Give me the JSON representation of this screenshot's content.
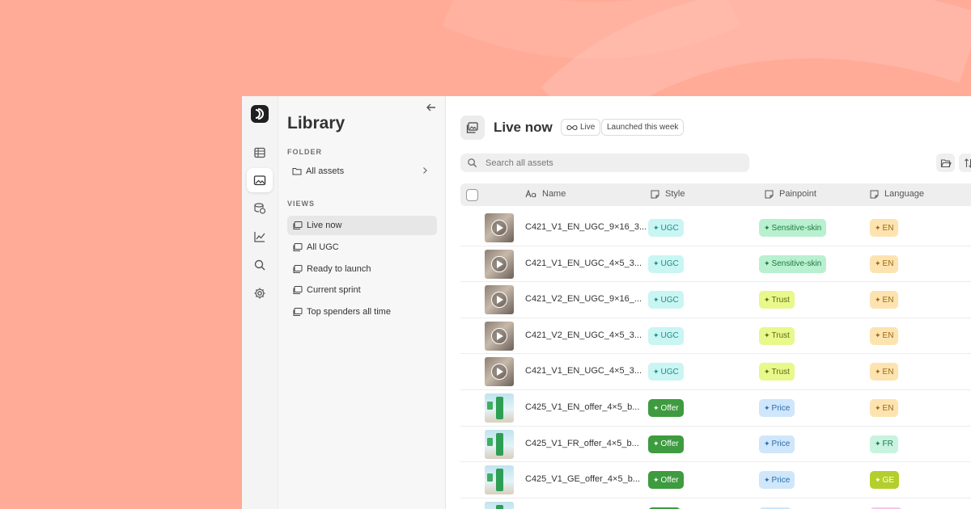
{
  "colors": {
    "background": "#ffab98",
    "tag_ugc_bg": "#c9f5f3",
    "tag_ugc_fg": "#1b8f8a",
    "tag_offer_bg": "#3e9b3f",
    "tag_offer_fg": "#ffffff",
    "tag_sensitive_bg": "#b9f0cf",
    "tag_sensitive_fg": "#1f7a44",
    "tag_trust_bg": "#e8f88b",
    "tag_trust_fg": "#5d6b12",
    "tag_price_bg": "#cfe6fb",
    "tag_price_fg": "#2d6ea8",
    "tag_en_bg": "#fde3b0",
    "tag_en_fg": "#9a6a14",
    "tag_fr_bg": "#c7f3df",
    "tag_fr_fg": "#1f7a55",
    "tag_ge_bg": "#b4cf2c",
    "tag_ge_fg": "#ffffff"
  },
  "rail": {
    "items": [
      {
        "name": "table-icon",
        "active": false
      },
      {
        "name": "image-folder-icon",
        "active": true
      },
      {
        "name": "coins-icon",
        "active": false
      },
      {
        "name": "trend-chart-icon",
        "active": false
      },
      {
        "name": "search-icon",
        "active": false
      },
      {
        "name": "gear-icon",
        "active": false
      }
    ]
  },
  "library": {
    "title": "Library",
    "folder_label": "FOLDER",
    "folder_item": "All assets",
    "views_label": "VIEWS",
    "views": [
      "Live now",
      "All UGC",
      "Ready to launch",
      "Current sprint",
      "Top spenders all time"
    ]
  },
  "main": {
    "title": "Live now",
    "chips": [
      "Live",
      "Launched this week"
    ],
    "search_placeholder": "Search all assets",
    "columns": [
      "Name",
      "Style",
      "Painpoint",
      "Language"
    ],
    "rows": [
      {
        "thumb": "ugc",
        "name": "C421_V1_EN_UGC_9×16_3...",
        "style": "UGC",
        "painpoint": "Sensitive-skin",
        "language": "EN"
      },
      {
        "thumb": "ugc",
        "name": "C421_V1_EN_UGC_4×5_3...",
        "style": "UGC",
        "painpoint": "Sensitive-skin",
        "language": "EN"
      },
      {
        "thumb": "ugc",
        "name": "C421_V2_EN_UGC_9×16_...",
        "style": "UGC",
        "painpoint": "Trust",
        "language": "EN"
      },
      {
        "thumb": "ugc",
        "name": "C421_V2_EN_UGC_4×5_3...",
        "style": "UGC",
        "painpoint": "Trust",
        "language": "EN"
      },
      {
        "thumb": "ugc",
        "name": "C421_V1_EN_UGC_4×5_3...",
        "style": "UGC",
        "painpoint": "Trust",
        "language": "EN"
      },
      {
        "thumb": "offer",
        "name": "C425_V1_EN_offer_4×5_b...",
        "style": "Offer",
        "painpoint": "Price",
        "language": "EN"
      },
      {
        "thumb": "offer",
        "name": "C425_V1_FR_offer_4×5_b...",
        "style": "Offer",
        "painpoint": "Price",
        "language": "FR"
      },
      {
        "thumb": "offer",
        "name": "C425_V1_GE_offer_4×5_b...",
        "style": "Offer",
        "painpoint": "Price",
        "language": "GE"
      },
      {
        "thumb": "offer",
        "name": "",
        "style": "",
        "painpoint": "",
        "language": ""
      }
    ]
  }
}
